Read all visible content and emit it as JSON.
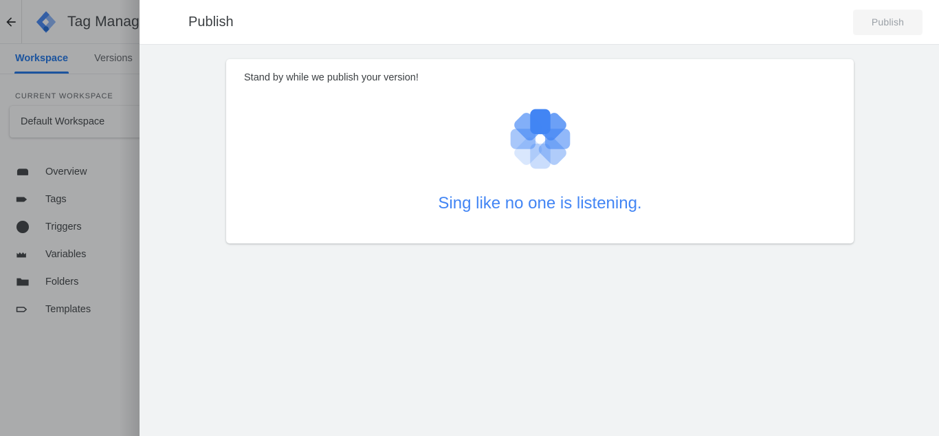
{
  "colors": {
    "accent": "#1a73e8",
    "quote": "#4285f4",
    "page_bg": "#f1f3f4",
    "card_bg": "#ffffff",
    "text": "#3c4043",
    "muted": "#5f6368",
    "disabled_btn_bg": "#f5f5f5",
    "disabled_btn_text": "#9aa0a6",
    "scrim": "rgba(32,33,36,.38)"
  },
  "nav": {
    "back_icon": "back-arrow-icon",
    "logo_icon": "tag-manager-logo-icon",
    "product_name": "Tag Manager",
    "tabs": [
      {
        "label": "Workspace",
        "active": true
      },
      {
        "label": "Versions",
        "active": false
      }
    ],
    "section_label": "CURRENT WORKSPACE",
    "workspace": {
      "name": "Default Workspace",
      "chevron_icon": "chevron-right-icon"
    },
    "items": [
      {
        "label": "Overview",
        "icon": "overview-icon"
      },
      {
        "label": "Tags",
        "icon": "tag-icon"
      },
      {
        "label": "Triggers",
        "icon": "trigger-icon"
      },
      {
        "label": "Variables",
        "icon": "variables-icon"
      },
      {
        "label": "Folders",
        "icon": "folder-icon"
      },
      {
        "label": "Templates",
        "icon": "template-icon"
      }
    ]
  },
  "panel": {
    "title": "Publish",
    "publish_button": {
      "label": "Publish",
      "disabled": true
    },
    "card": {
      "message": "Stand by while we publish your version!",
      "spinner_icon": "gtm-loading-spinner-icon",
      "quote": "Sing like no one is listening."
    }
  }
}
